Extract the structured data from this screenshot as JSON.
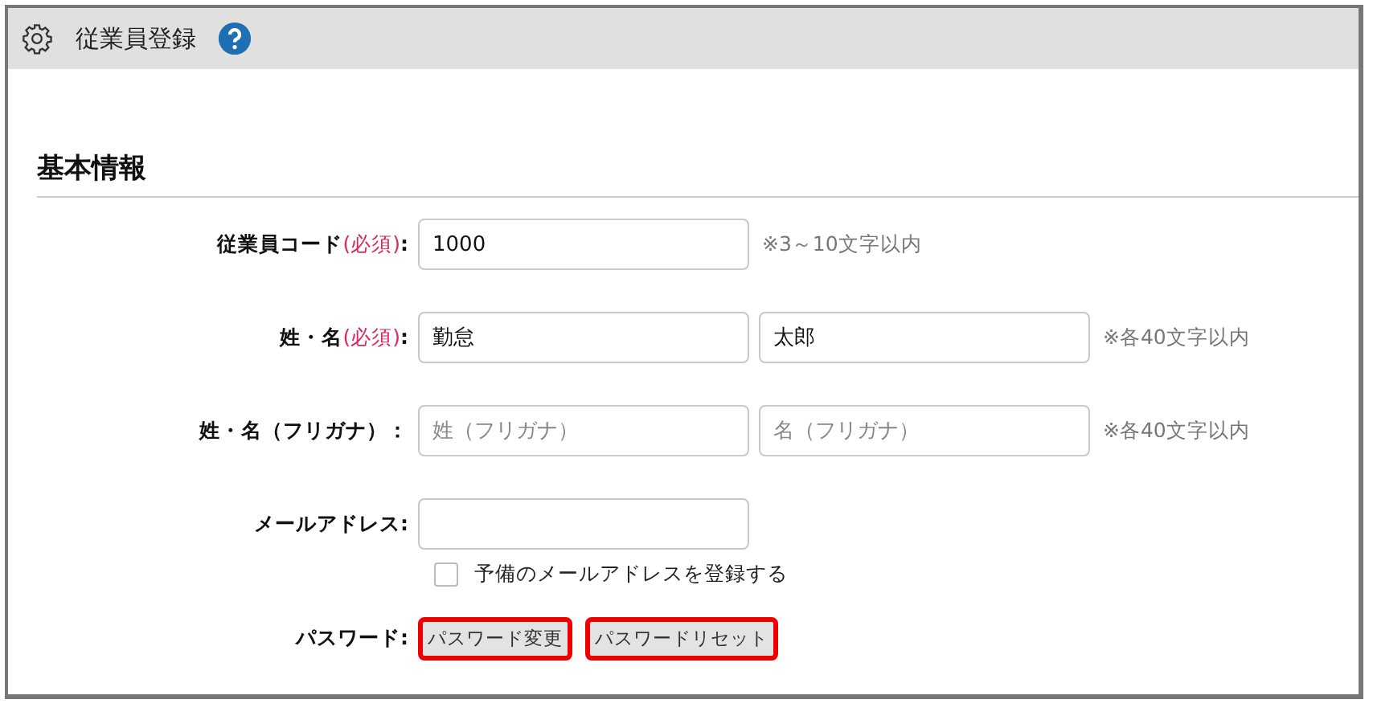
{
  "header": {
    "title": "従業員登録"
  },
  "section": {
    "title": "基本情報"
  },
  "rows": [
    {
      "kind": "fields",
      "label": "従業員コード",
      "required": "(必須)",
      "colon": ":",
      "fields": [
        {
          "value": "1000"
        }
      ],
      "note": "※3～10文字以内"
    },
    {
      "kind": "fields",
      "label": "姓・名",
      "required": "(必須)",
      "colon": ":",
      "fields": [
        {
          "value": "勤怠"
        },
        {
          "value": "太郎"
        }
      ],
      "note": "※各40文字以内"
    },
    {
      "kind": "fields",
      "label": "姓・名（フリガナ）：",
      "fields": [
        {
          "placeholder": "姓（フリガナ）"
        },
        {
          "placeholder": "名（フリガナ）"
        }
      ],
      "note": "※各40文字以内"
    },
    {
      "kind": "empty-field",
      "label": "メールアドレス",
      "colon": ":"
    },
    {
      "kind": "checkbox",
      "text": "予備のメールアドレスを登録する",
      "checked": false
    },
    {
      "kind": "buttons",
      "label": "パスワード",
      "colon": ":",
      "buttons": [
        "パスワード変更",
        "パスワードリセット"
      ]
    }
  ]
}
